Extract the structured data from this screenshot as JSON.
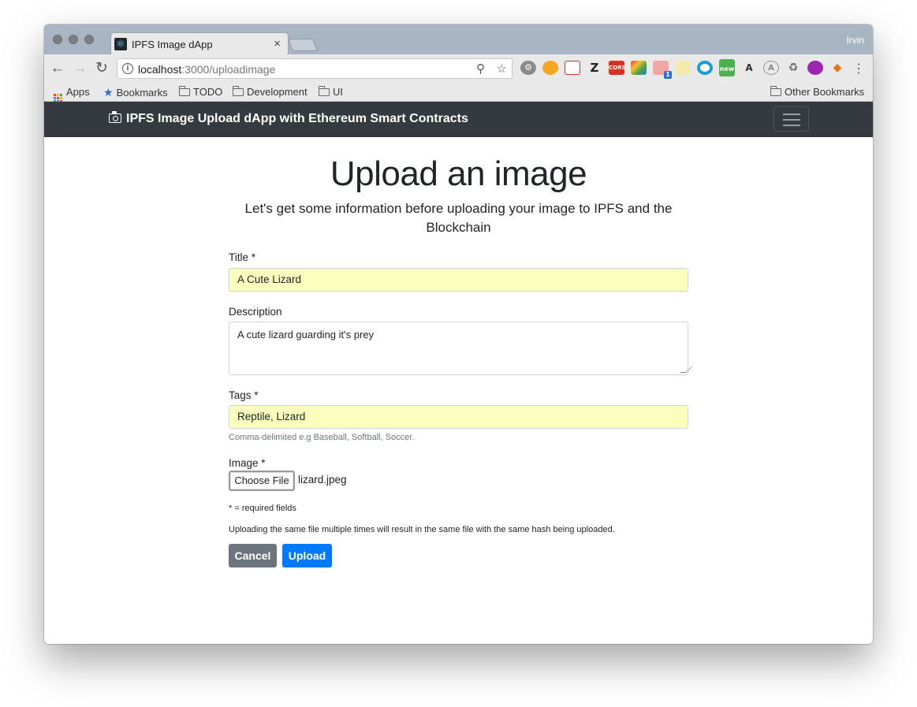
{
  "browser": {
    "tab_title": "IPFS Image dApp",
    "tab_close": "×",
    "profile_name": "Irvin",
    "url_host": "localhost",
    "url_path": ":3000/uploadimage",
    "bookmarks": {
      "apps": "Apps",
      "bookmarks": "Bookmarks",
      "todo": "TODO",
      "development": "Development",
      "ui": "UI",
      "other": "Other Bookmarks"
    },
    "ext_labels": {
      "z": "Z",
      "cors": "CORS",
      "badge": "1",
      "new": "new",
      "translate": "A",
      "a": "A"
    }
  },
  "navbar": {
    "brand": "IPFS Image Upload dApp with Ethereum Smart Contracts"
  },
  "form": {
    "heading": "Upload an image",
    "lead": "Let's get some information before uploading your image to IPFS and the Blockchain",
    "title_label": "Title *",
    "title_value": "A Cute Lizard",
    "description_label": "Description",
    "description_value": "A cute lizard guarding it's prey",
    "tags_label": "Tags *",
    "tags_value": "Reptile, Lizard",
    "tags_help": "Comma-delimited e.g Baseball, Softball, Soccer.",
    "image_label": "Image *",
    "choose_file_label": "Choose File",
    "file_name": "lizard.jpeg",
    "required_note": "* = required fields",
    "hash_note": "Uploading the same file multiple times will result in the same file with the same hash being uploaded.",
    "cancel_label": "Cancel",
    "upload_label": "Upload"
  },
  "colors": {
    "navbar_bg": "#343a40",
    "autofill_bg": "#faffbd",
    "cancel_bg": "#6c757d",
    "upload_bg": "#007bff"
  }
}
